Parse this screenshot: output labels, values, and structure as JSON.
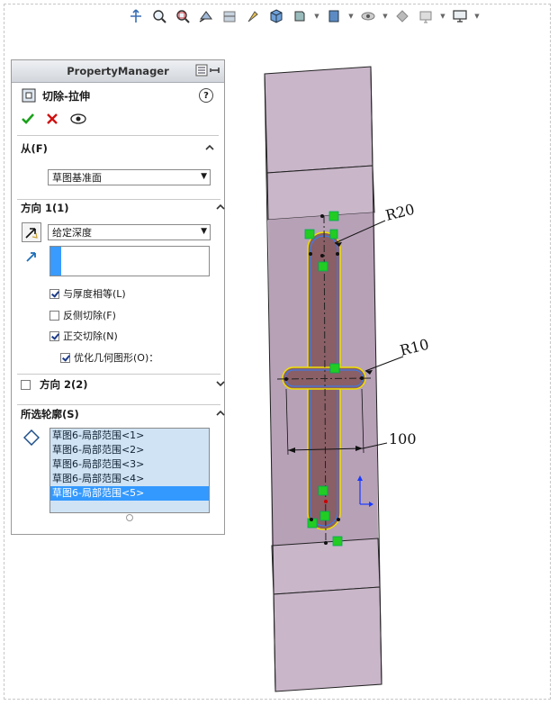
{
  "panel": {
    "header": "PropertyManager",
    "feature_title": "切除-拉伸",
    "from": {
      "label": "从(F)",
      "value": "草图基准面"
    },
    "direction1": {
      "label": "方向 1(1)",
      "end_condition": "给定深度",
      "options": [
        {
          "label": "与厚度相等(L)",
          "checked": true
        },
        {
          "label": "反侧切除(F)",
          "checked": false
        },
        {
          "label": "正交切除(N)",
          "checked": true
        },
        {
          "label": "优化几何图形(O)：",
          "checked": true
        }
      ]
    },
    "direction2": {
      "label": "方向 2(2)",
      "checked": false
    },
    "contours": {
      "label": "所选轮廓(S)",
      "items": [
        "草图6-局部范围<1>",
        "草图6-局部范围<2>",
        "草图6-局部范围<3>",
        "草图6-局部范围<4>",
        "草图6-局部范围<5>"
      ],
      "selected_index": 4
    }
  },
  "toolbar": {
    "icons": [
      "view-orient-icon",
      "zoom-fit-icon",
      "zoom-area-icon",
      "previous-view-icon",
      "section-view-icon",
      "dynamic-annotation-icon",
      "view-orientation-icon",
      "display-style-icon",
      "hide-show-icon",
      "edit-appearance-icon",
      "apply-scene-icon",
      "view-settings-icon"
    ]
  },
  "annotations": {
    "r20": "R20",
    "r10": "R10",
    "dim100": "100"
  },
  "colors": {
    "part_face": "#c9b6c9",
    "accent_blue": "#3399ff",
    "ok_green": "#1aa11a",
    "cancel_red": "#d01010",
    "handle_green": "#22cc22"
  }
}
